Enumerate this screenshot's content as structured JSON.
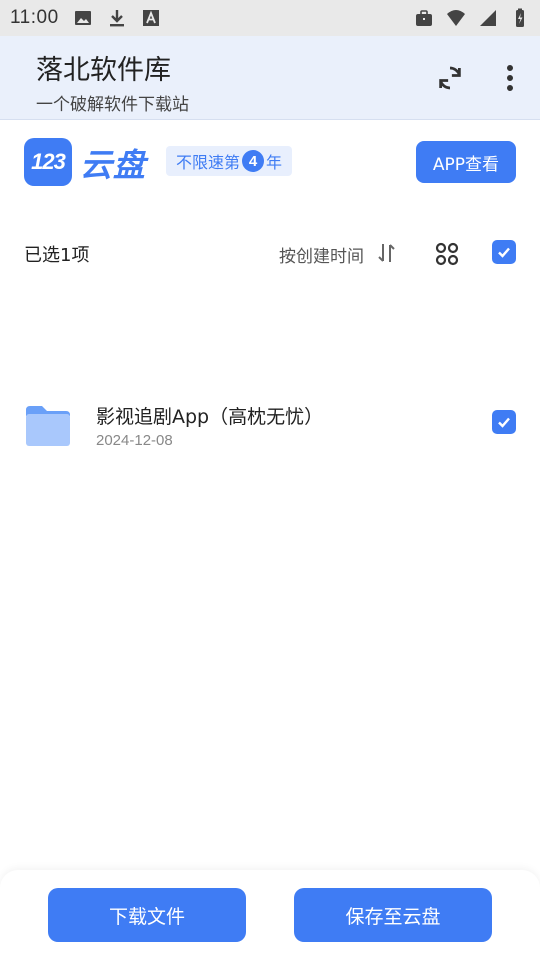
{
  "status_bar": {
    "time": "11:00",
    "left_icons": [
      "image-icon",
      "download-icon",
      "font-icon"
    ],
    "right_icons": [
      "briefcase-icon",
      "wifi-icon",
      "signal-icon",
      "battery-icon"
    ]
  },
  "header": {
    "title": "落北软件库",
    "subtitle": "一个破解软件下载站"
  },
  "brand": {
    "logo_number": "123",
    "logo_text": "云盘",
    "promo_prefix": "不限速第",
    "promo_number": "4",
    "promo_suffix": "年",
    "app_view_label": "APP查看"
  },
  "toolbar": {
    "selected_count": "已选1项",
    "sort_label": "按创建时间"
  },
  "files": [
    {
      "name": "影视追剧App（高枕无忧）",
      "date": "2024-12-08",
      "checked": true
    }
  ],
  "bottom": {
    "download_label": "下载文件",
    "save_label": "保存至云盘"
  },
  "colors": {
    "accent": "#3f7cf4",
    "header_bg": "#eaf0fb",
    "status_bg": "#e9e9e9"
  }
}
